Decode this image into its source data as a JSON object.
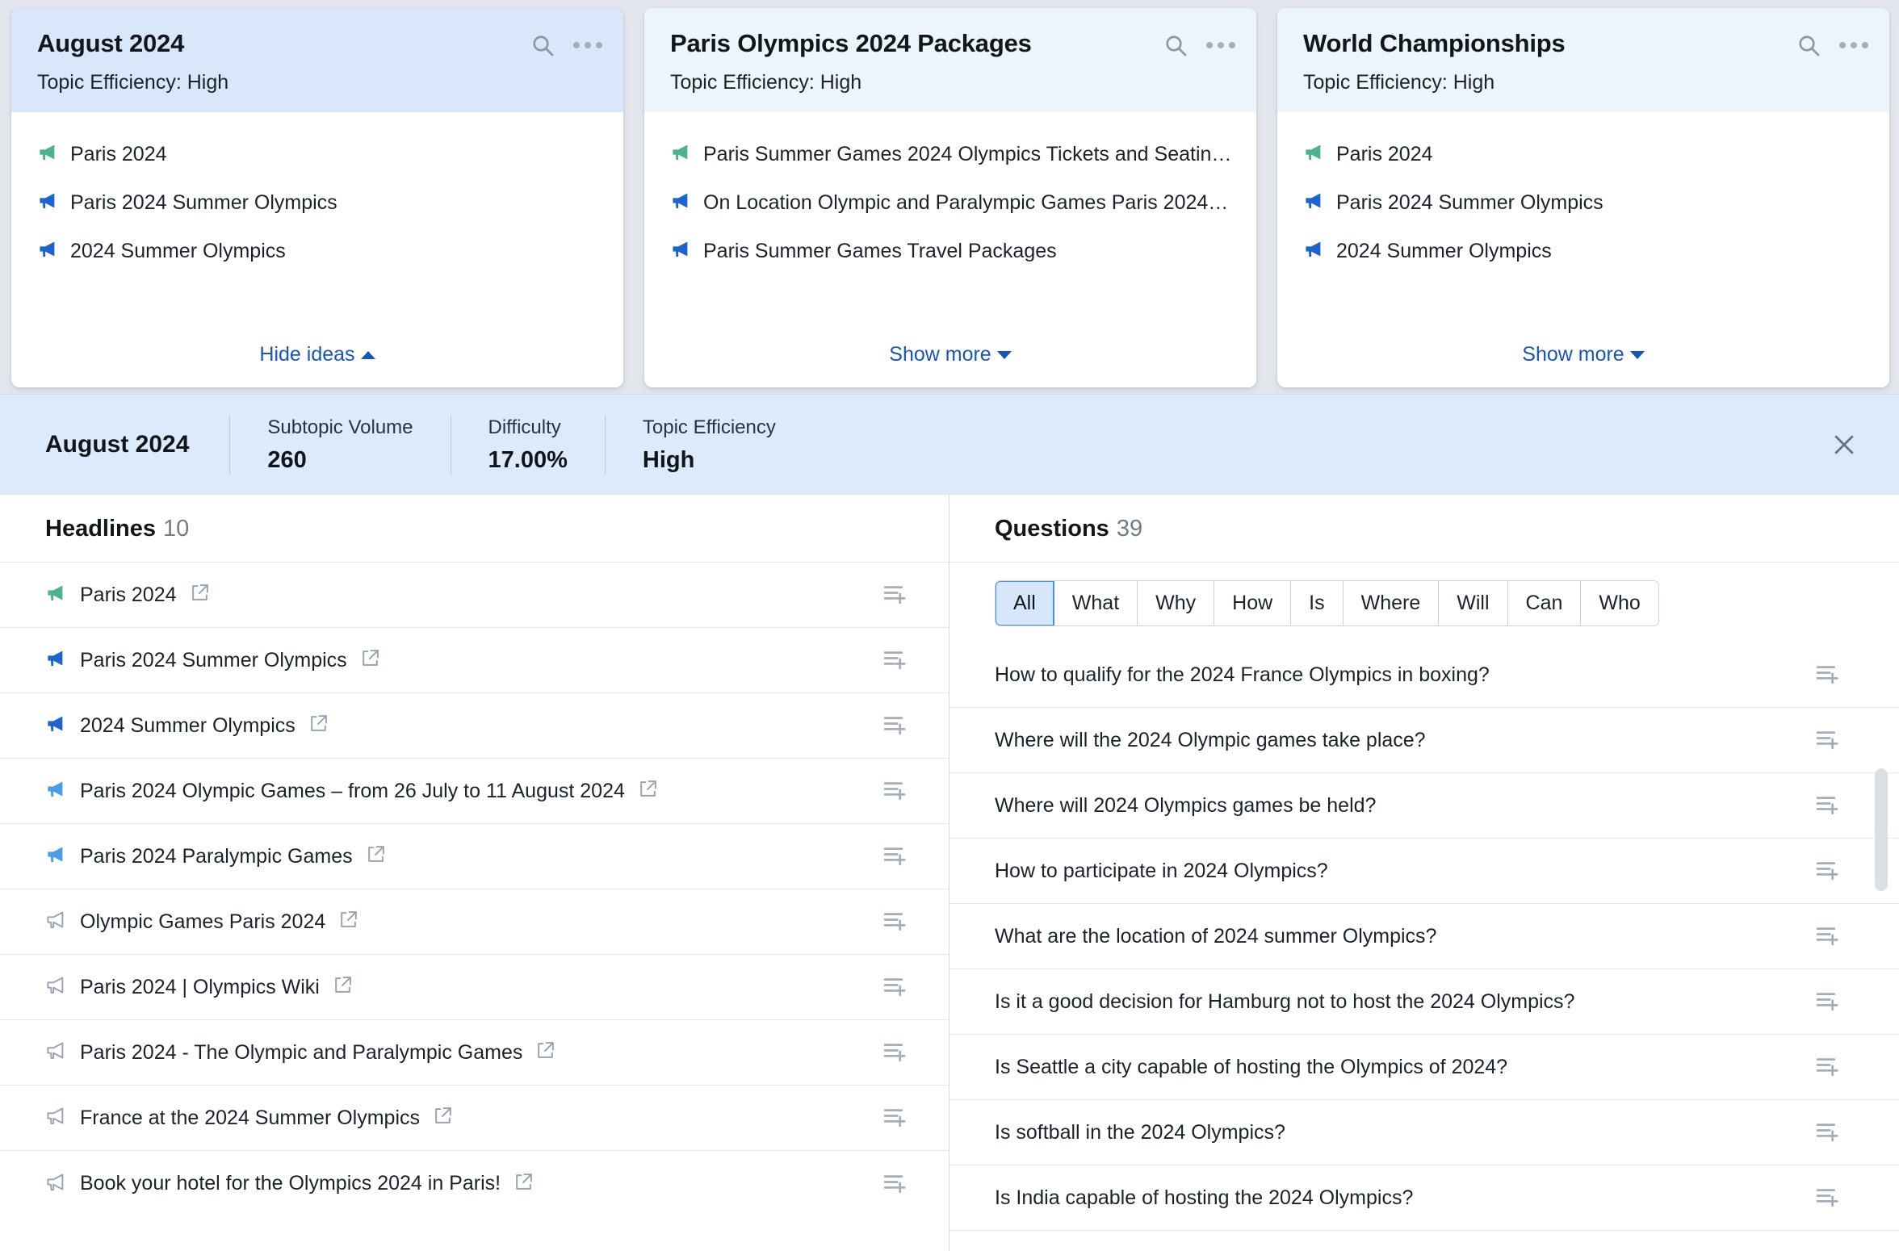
{
  "colors": {
    "accent_link": "#1a56b8",
    "selected_header": "#d8e8fa",
    "card_header": "#edf5fc",
    "metric_bar": "#ddeafb",
    "megaphone_green": "#4cb488",
    "megaphone_blue": "#1f63ce",
    "megaphone_lightblue": "#4a9ce8",
    "megaphone_gray": "#9aa2b1"
  },
  "cards": [
    {
      "title": "August 2024",
      "subtitle": "Topic Efficiency: High",
      "selected": true,
      "ideas": [
        {
          "text": "Paris 2024",
          "tone": "green"
        },
        {
          "text": "Paris 2024 Summer Olympics",
          "tone": "blue"
        },
        {
          "text": "2024 Summer Olympics",
          "tone": "blue"
        }
      ],
      "footer_label": "Hide ideas",
      "footer_dir": "up"
    },
    {
      "title": "Paris Olympics 2024 Packages",
      "subtitle": "Topic Efficiency: High",
      "selected": false,
      "ideas": [
        {
          "text": "Paris Summer Games 2024 Olympics Tickets and Seating…",
          "tone": "green"
        },
        {
          "text": "On Location Olympic and Paralympic Games Paris 2024: …",
          "tone": "blue"
        },
        {
          "text": "Paris Summer Games Travel Packages",
          "tone": "blue"
        }
      ],
      "footer_label": "Show more",
      "footer_dir": "down"
    },
    {
      "title": "World Championships",
      "subtitle": "Topic Efficiency: High",
      "selected": false,
      "ideas": [
        {
          "text": "Paris 2024",
          "tone": "green"
        },
        {
          "text": "Paris 2024 Summer Olympics",
          "tone": "blue"
        },
        {
          "text": "2024 Summer Olympics",
          "tone": "blue"
        }
      ],
      "footer_label": "Show more",
      "footer_dir": "down"
    }
  ],
  "metric_bar": {
    "title": "August 2024",
    "metrics": [
      {
        "label": "Subtopic Volume",
        "value": "260"
      },
      {
        "label": "Difficulty",
        "value": "17.00%"
      },
      {
        "label": "Topic Efficiency",
        "value": "High"
      }
    ],
    "close_icon": "close-icon"
  },
  "headlines": {
    "title": "Headlines",
    "count": "10",
    "items": [
      {
        "text": "Paris 2024",
        "tone": "green"
      },
      {
        "text": "Paris 2024 Summer Olympics",
        "tone": "blue"
      },
      {
        "text": "2024 Summer Olympics",
        "tone": "blue"
      },
      {
        "text": "Paris 2024 Olympic Games – from 26 July to 11 August 2024",
        "tone": "lightblue"
      },
      {
        "text": "Paris 2024 Paralympic Games",
        "tone": "lightblue"
      },
      {
        "text": "Olympic Games Paris 2024",
        "tone": "gray"
      },
      {
        "text": "Paris 2024 | Olympics Wiki",
        "tone": "gray"
      },
      {
        "text": "Paris 2024 - The Olympic and Paralympic Games",
        "tone": "gray"
      },
      {
        "text": "France at the 2024 Summer Olympics",
        "tone": "gray"
      },
      {
        "text": "Book your hotel for the Olympics 2024 in Paris!",
        "tone": "gray"
      }
    ]
  },
  "questions": {
    "title": "Questions",
    "count": "39",
    "filters": [
      {
        "label": "All",
        "active": true
      },
      {
        "label": "What",
        "active": false
      },
      {
        "label": "Why",
        "active": false
      },
      {
        "label": "How",
        "active": false
      },
      {
        "label": "Is",
        "active": false
      },
      {
        "label": "Where",
        "active": false
      },
      {
        "label": "Will",
        "active": false
      },
      {
        "label": "Can",
        "active": false
      },
      {
        "label": "Who",
        "active": false
      }
    ],
    "items": [
      {
        "text": "How to qualify for the 2024 France Olympics in boxing?"
      },
      {
        "text": "Where will the 2024 Olympic games take place?"
      },
      {
        "text": "Where will 2024 Olympics games be held?"
      },
      {
        "text": "How to participate in 2024 Olympics?"
      },
      {
        "text": "What are the location of 2024 summer Olympics?"
      },
      {
        "text": "Is it a good decision for Hamburg not to host the 2024 Olympics?"
      },
      {
        "text": "Is Seattle a city capable of hosting the Olympics of 2024?"
      },
      {
        "text": "Is softball in the 2024 Olympics?"
      },
      {
        "text": "Is India capable of hosting the 2024 Olympics?"
      }
    ]
  }
}
